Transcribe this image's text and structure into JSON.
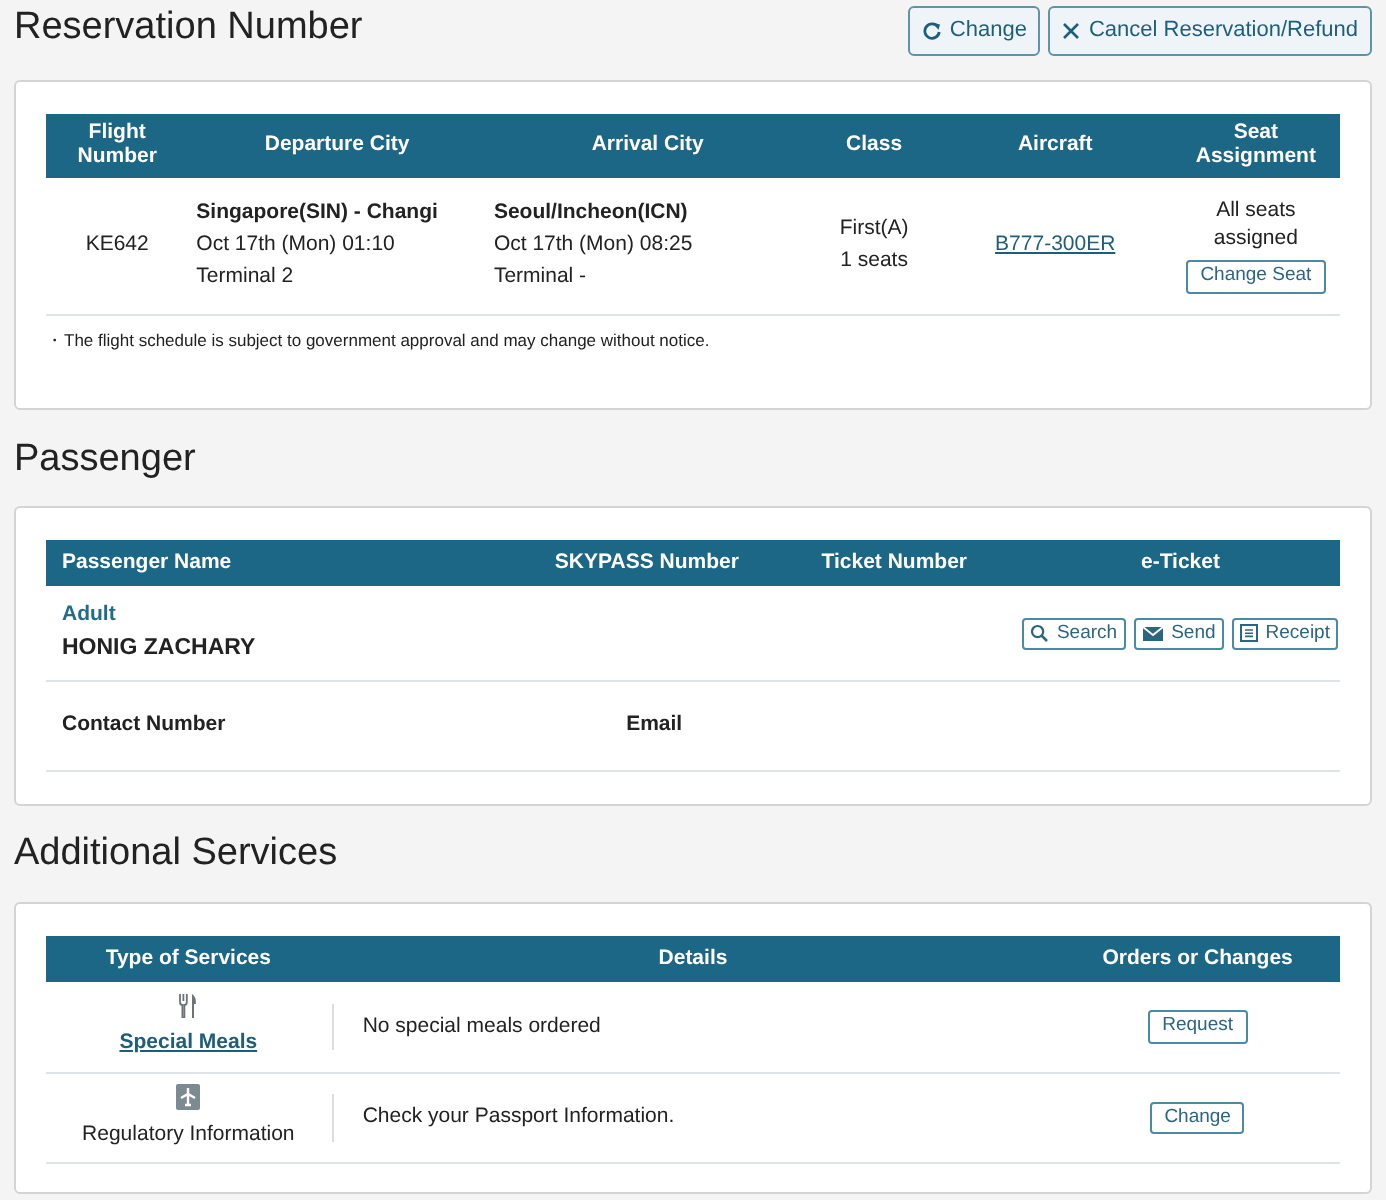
{
  "reservation": {
    "title": "Reservation Number",
    "actions": [
      {
        "kind": "refresh",
        "label": "Change"
      },
      {
        "kind": "close",
        "label": "Cancel Reservation/Refund"
      }
    ],
    "flight_table": {
      "columns": [
        "Flight Number",
        "Departure City",
        "Arrival City",
        "Class",
        "Aircraft",
        "Seat Assignment"
      ],
      "rows": [
        {
          "flight_number": "KE642",
          "departure": {
            "city": "Singapore(SIN) - Changi",
            "time": "Oct 17th (Mon) 01:10",
            "terminal": "Terminal 2"
          },
          "arrival": {
            "city": "Seoul/Incheon(ICN)",
            "time": "Oct 17th (Mon) 08:25",
            "terminal": "Terminal -"
          },
          "class": "First(A)",
          "seats": "1 seats",
          "aircraft": "B777-300ER",
          "seat_status": "All seats assigned",
          "seat_button": "Change Seat"
        }
      ]
    },
    "note": "・The flight schedule is subject to government approval and may change without notice."
  },
  "passenger": {
    "title": "Passenger",
    "columns": [
      "Passenger Name",
      "SKYPASS Number",
      "Ticket Number",
      "e-Ticket"
    ],
    "passengers": [
      {
        "type": "Adult",
        "name": "HONIG ZACHARY",
        "eticket_buttons": [
          {
            "kind": "search",
            "label": "Search"
          },
          {
            "kind": "mail",
            "label": "Send"
          },
          {
            "kind": "receipt",
            "label": "Receipt"
          }
        ]
      }
    ],
    "contact_labels": [
      "Contact Number",
      "Email"
    ]
  },
  "services": {
    "title": "Additional Services",
    "columns": [
      "Type of Services",
      "Details",
      "Orders or Changes"
    ],
    "rows": [
      {
        "kind": "meals",
        "link": true,
        "name": "Special Meals",
        "details": "No special meals ordered",
        "action": "Request"
      },
      {
        "kind": "regulatory",
        "link": false,
        "name": "Regulatory Information",
        "details": "Check your Passport Information.",
        "action": "Change"
      }
    ]
  }
}
